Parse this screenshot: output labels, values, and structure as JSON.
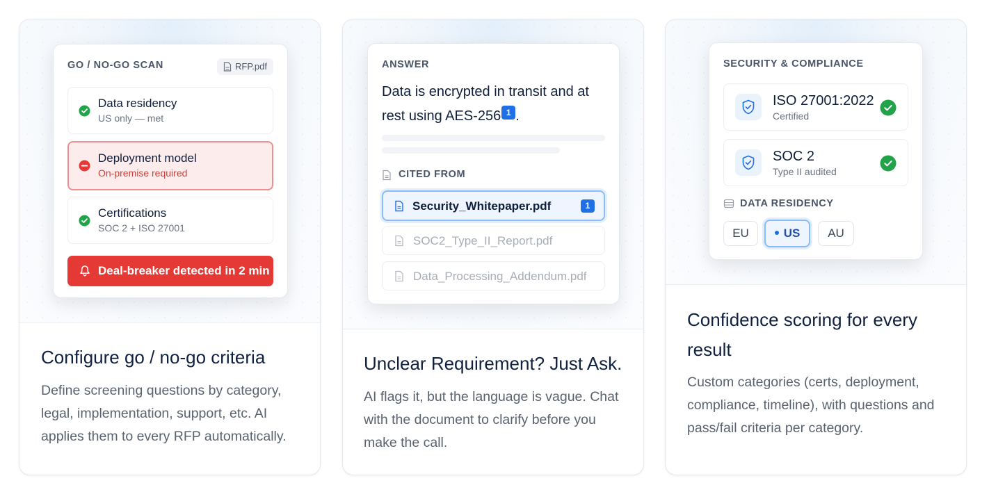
{
  "cards": [
    {
      "panel": {
        "caption": "GO / NO-GO SCAN",
        "file_badge": "RFP.pdf",
        "criteria": [
          {
            "title": "Data residency",
            "subtitle": "US only — met",
            "status": "pass"
          },
          {
            "title": "Deployment model",
            "subtitle": "On-premise required",
            "status": "fail"
          },
          {
            "title": "Certifications",
            "subtitle": "SOC 2 + ISO 27001",
            "status": "pass"
          }
        ],
        "alert": "Deal-breaker detected in 2 min"
      },
      "title": "Configure go / no-go criteria",
      "description": "Define screening questions by category, legal, implementation, support, etc. AI applies them to every RFP automatically."
    },
    {
      "panel": {
        "caption": "ANSWER",
        "answer_line1": "Data is encrypted in transit and at",
        "answer_line2": "rest using AES-256",
        "citation_marker": "1",
        "answer_end": ".",
        "cited_caption": "CITED FROM",
        "files": [
          {
            "name": "Security_Whitepaper.pdf",
            "badge": "1",
            "active": true
          },
          {
            "name": "SOC2_Type_II_Report.pdf"
          },
          {
            "name": "Data_Processing_Addendum.pdf"
          }
        ]
      },
      "title": "Unclear Requirement? Just Ask.",
      "description": "AI flags it, but the language is vague. Chat with the document to clarify before you make the call."
    },
    {
      "panel": {
        "caption": "SECURITY & COMPLIANCE",
        "certs": [
          {
            "title": "ISO 27001:2022",
            "subtitle": "Certified"
          },
          {
            "title": "SOC 2",
            "subtitle": "Type II audited"
          }
        ],
        "residency_caption": "DATA RESIDENCY",
        "regions": [
          {
            "label": "EU",
            "selected": false
          },
          {
            "label": "US",
            "selected": true
          },
          {
            "label": "AU",
            "selected": false
          }
        ]
      },
      "title": "Confidence scoring for every result",
      "description": "Custom categories (certs, deployment, compliance, timeline), with questions and pass/fail criteria per category."
    }
  ],
  "colors": {
    "pass": "#22a34a",
    "fail": "#e53935",
    "accent": "#1f6fe5",
    "heading": "#10213f"
  }
}
